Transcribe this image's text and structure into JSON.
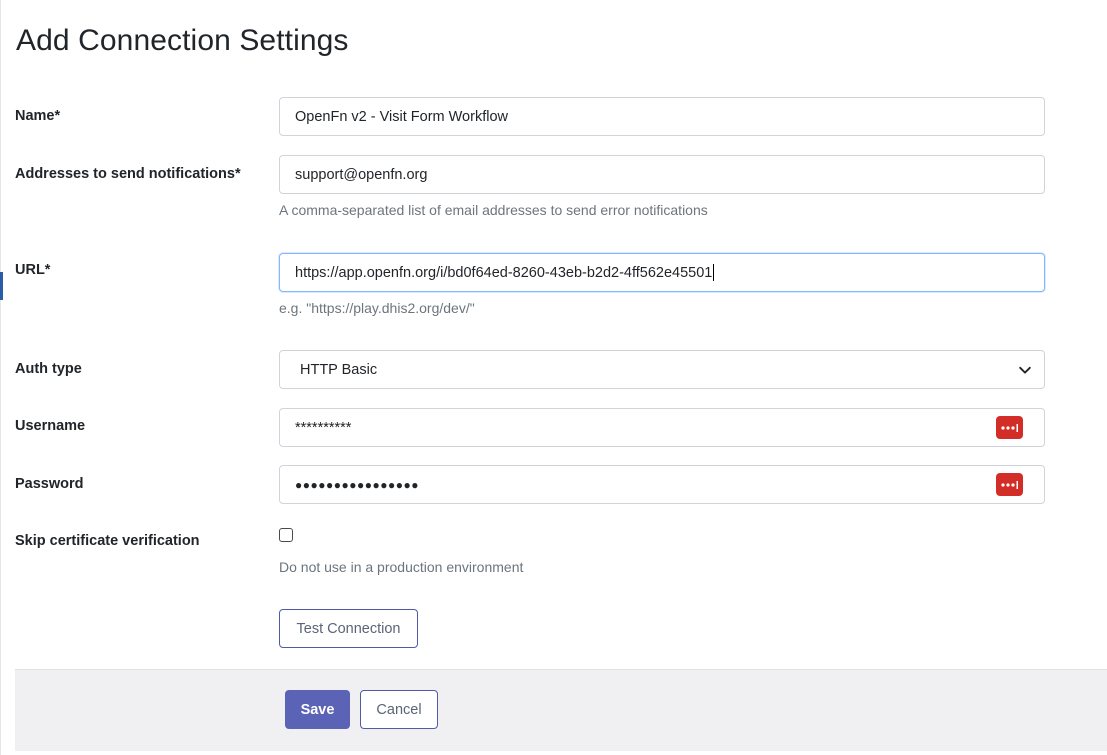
{
  "page": {
    "title": "Add Connection Settings"
  },
  "form": {
    "name": {
      "label": "Name*",
      "value": "OpenFn v2 - Visit Form Workflow"
    },
    "addresses": {
      "label": "Addresses to send notifications*",
      "value": "support@openfn.org",
      "help": "A comma-separated list of email addresses to send error notifications"
    },
    "url": {
      "label": "URL*",
      "value": "https://app.openfn.org/i/bd0f64ed-8260-43eb-b2d2-4ff562e45501",
      "help": "e.g. \"https://play.dhis2.org/dev/\""
    },
    "auth_type": {
      "label": "Auth type",
      "selected": "HTTP Basic"
    },
    "username": {
      "label": "Username",
      "value": "**********"
    },
    "password": {
      "label": "Password",
      "value": "●●●●●●●●●●●●●●●●"
    },
    "skip_cert": {
      "label": "Skip certificate verification",
      "checked": false,
      "help": "Do not use in a production environment"
    },
    "test_connection_label": "Test Connection"
  },
  "footer": {
    "save_label": "Save",
    "cancel_label": "Cancel"
  },
  "colors": {
    "primary": "#5b63b7",
    "password_manager_icon": "#d32d27",
    "focus_border": "#86b7fe"
  },
  "icons": {
    "select": "chevron-down-icon",
    "password_manager": "password-manager-icon"
  }
}
